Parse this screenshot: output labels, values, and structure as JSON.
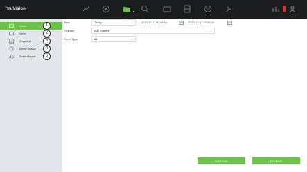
{
  "brand": {
    "logo_symbol": "®",
    "logo_text": "truVision"
  },
  "topbar": {
    "icons": [
      "live-view-icon",
      "playback-icon",
      "folder-search-icon",
      "device-search-icon",
      "display-icon",
      "storage-icon",
      "config-icon",
      "maintenance-icon",
      "alarm-icon",
      "record-indicator-icon",
      "user-icon"
    ],
    "accent": "#6cc24a",
    "record_color": "#d9342b"
  },
  "sidebar": {
    "items": [
      {
        "label": "Video",
        "badge": "1",
        "active": true
      },
      {
        "label": "Video",
        "badge": "2",
        "active": false
      },
      {
        "label": "Snapshot",
        "badge": "3",
        "active": false
      },
      {
        "label": "Event Search",
        "badge": "4",
        "active": false
      },
      {
        "label": "Event Report",
        "badge": "5",
        "active": false
      }
    ]
  },
  "form": {
    "time_label": "Time",
    "time_value": "Today",
    "start_time": "2023-12-11 00:00:00",
    "end_time": "2023-12-11 23:59:59",
    "channel_label": "Channel",
    "channel_value": "[All] Camera",
    "event_type_label": "Event Type",
    "event_type_value": "All"
  },
  "actions": {
    "search_label": "Search Image",
    "export_label": "Mark Search"
  }
}
